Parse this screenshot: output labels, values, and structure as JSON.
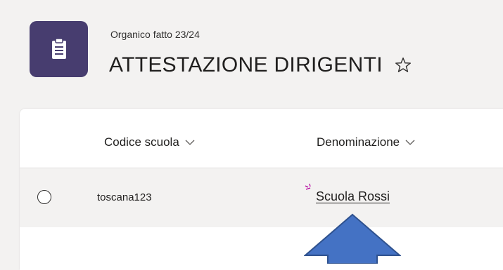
{
  "header": {
    "subtitle": "Organico fatto 23/24",
    "title": "ATTESTAZIONE DIRIGENTI",
    "app_icon": "clipboard-icon",
    "favorite_icon": "star-outline-icon"
  },
  "table": {
    "columns": [
      {
        "label": "Codice scuola",
        "icon": "chevron-down-icon"
      },
      {
        "label": "Denominazione",
        "icon": "chevron-down-icon"
      }
    ],
    "rows": [
      {
        "codice": "toscana123",
        "denominazione": "Scuola Rossi"
      }
    ]
  },
  "annotation": {
    "arrow_color": "#4472c4",
    "arrow_border": "#2f528f"
  },
  "colors": {
    "app_icon_bg": "#473d6f",
    "page_bg": "#f3f2f1",
    "sparkle": "#b4009e"
  }
}
